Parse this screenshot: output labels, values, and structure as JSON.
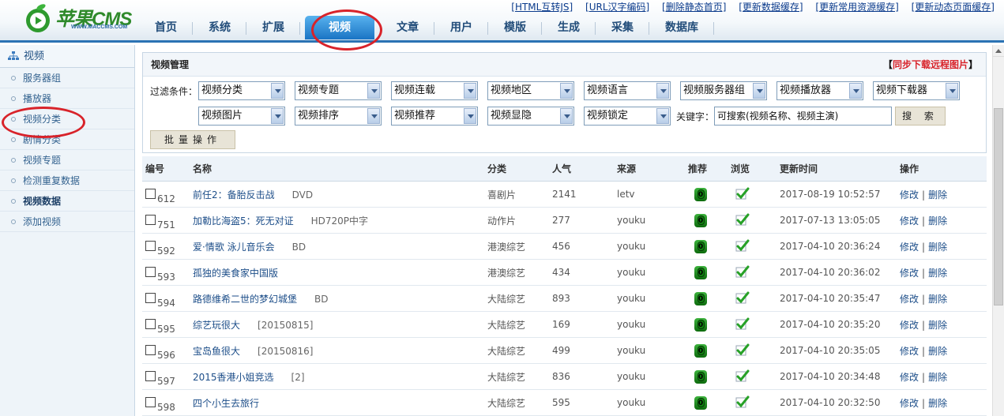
{
  "logo": {
    "text": "苹果CMS",
    "url": "WWW.MACCMS.COM"
  },
  "toplinks": [
    "[HTML互转JS]",
    "[URL汉字编码]",
    "[删除静态首页]",
    "[更新数据缓存]",
    "[更新常用资源缓存]",
    "[更新动态页面缓存]"
  ],
  "nav": {
    "items": [
      "首页",
      "系统",
      "扩展",
      "视频",
      "文章",
      "用户",
      "模版",
      "生成",
      "采集",
      "数据库"
    ],
    "active": "视频"
  },
  "sidebar": {
    "title": "视频",
    "items": [
      "服务器组",
      "播放器",
      "视频分类",
      "剧情分类",
      "视频专题",
      "检测重复数据",
      "视频数据",
      "添加视频"
    ],
    "active": "视频数据"
  },
  "panel": {
    "title": "视频管理",
    "sync": {
      "open": "【",
      "label": "同步下载远程图片",
      "close": "】"
    },
    "filter_label": "过滤条件：",
    "keyword_label": "关键字：",
    "keyword_value": "可搜索(视频名称、视频主演)",
    "search_button": "搜 索",
    "batch_button": "批量操作",
    "selects_row1": [
      "视频分类",
      "视频专题",
      "视频连载",
      "视频地区",
      "视频语言",
      "视频服务器组",
      "视频播放器",
      "视频下载器"
    ],
    "selects_row2": [
      "视频图片",
      "视频排序",
      "视频推荐",
      "视频显隐",
      "视频锁定"
    ]
  },
  "table": {
    "headers": [
      "编号",
      "名称",
      "分类",
      "人气",
      "来源",
      "推荐",
      "浏览",
      "更新时间",
      "操作"
    ],
    "recommend_badge": "0",
    "op_edit": "修改",
    "op_sep": "|",
    "op_delete": "删除",
    "rows": [
      {
        "id": "612",
        "name": "前任2：备胎反击战",
        "note": "DVD",
        "category": "喜剧片",
        "popularity": "2141",
        "source": "letv",
        "updated": "2017-08-19 10:52:57"
      },
      {
        "id": "751",
        "name": "加勒比海盗5：死无对证",
        "note": "HD720P中字",
        "category": "动作片",
        "popularity": "277",
        "source": "youku",
        "updated": "2017-07-13 13:05:05"
      },
      {
        "id": "592",
        "name": "爱·情歌 泳儿音乐会",
        "note": "BD",
        "category": "港澳综艺",
        "popularity": "456",
        "source": "youku",
        "updated": "2017-04-10 20:36:24"
      },
      {
        "id": "593",
        "name": "孤独的美食家中国版",
        "note": "",
        "category": "港澳综艺",
        "popularity": "434",
        "source": "youku",
        "updated": "2017-04-10 20:36:02"
      },
      {
        "id": "594",
        "name": "路德维希二世的梦幻城堡",
        "note": "BD",
        "category": "大陆综艺",
        "popularity": "893",
        "source": "youku",
        "updated": "2017-04-10 20:35:47"
      },
      {
        "id": "595",
        "name": "综艺玩很大",
        "note": "[20150815]",
        "category": "大陆综艺",
        "popularity": "169",
        "source": "youku",
        "updated": "2017-04-10 20:35:20"
      },
      {
        "id": "596",
        "name": "宝岛鱼很大",
        "note": "[20150816]",
        "category": "大陆综艺",
        "popularity": "499",
        "source": "youku",
        "updated": "2017-04-10 20:35:05"
      },
      {
        "id": "597",
        "name": "2015香港小姐竞选",
        "note": "[2]",
        "category": "大陆综艺",
        "popularity": "836",
        "source": "youku",
        "updated": "2017-04-10 20:34:48"
      },
      {
        "id": "598",
        "name": "四个小生去旅行",
        "note": "",
        "category": "大陆综艺",
        "popularity": "595",
        "source": "youku",
        "updated": "2017-04-10 20:32:50"
      }
    ]
  },
  "colors": {
    "nav_accent": "#2b73b4",
    "annotation_red": "#d8232a",
    "link_blue": "#1d4e89"
  }
}
